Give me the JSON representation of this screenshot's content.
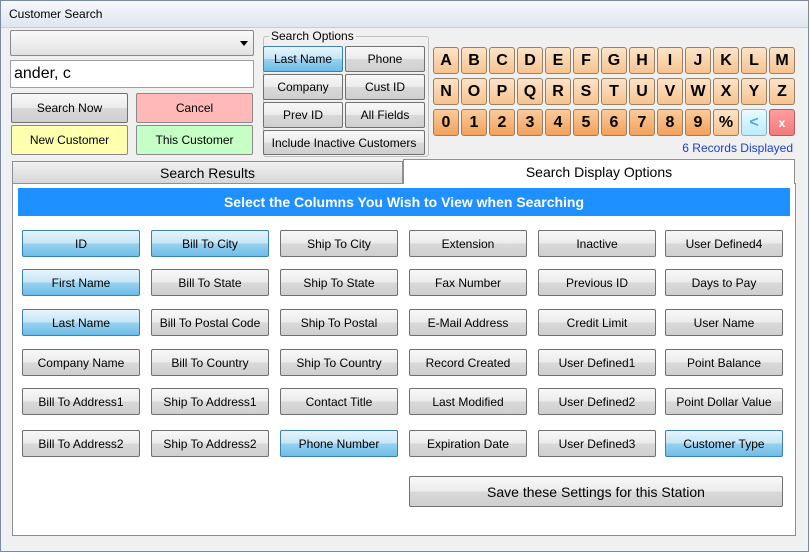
{
  "window": {
    "title": "Customer Search"
  },
  "search": {
    "combo_value": "",
    "text_value": "ander, c",
    "search_now": "Search Now",
    "cancel": "Cancel",
    "new_customer": "New Customer",
    "this_customer": "This Customer"
  },
  "options": {
    "legend": "Search Options",
    "last_name": "Last Name",
    "phone": "Phone",
    "company": "Company",
    "cust_id": "Cust ID",
    "prev_id": "Prev ID",
    "all_fields": "All Fields",
    "include_inactive": "Include Inactive Customers",
    "selected": "Last Name"
  },
  "keyboard": {
    "row1": [
      "A",
      "B",
      "C",
      "D",
      "E",
      "F",
      "G",
      "H",
      "I",
      "J",
      "K",
      "L",
      "M"
    ],
    "row2": [
      "N",
      "O",
      "P",
      "Q",
      "R",
      "S",
      "T",
      "U",
      "V",
      "W",
      "X",
      "Y",
      "Z"
    ],
    "row3": [
      "0",
      "1",
      "2",
      "3",
      "4",
      "5",
      "6",
      "7",
      "8",
      "9",
      "%",
      "<",
      "x"
    ]
  },
  "records_text": "6 Records Displayed",
  "tabs": {
    "results": "Search Results",
    "display_options": "Search Display Options",
    "active": "Search Display Options"
  },
  "banner": "Select the Columns You Wish to View when Searching",
  "columns": [
    [
      {
        "label": "ID",
        "selected": true
      },
      {
        "label": "Bill To City",
        "selected": true
      },
      {
        "label": "Ship To City",
        "selected": false
      },
      {
        "label": "Extension",
        "selected": false
      },
      {
        "label": "Inactive",
        "selected": false
      },
      {
        "label": "User Defined4",
        "selected": false
      }
    ],
    [
      {
        "label": "First Name",
        "selected": true
      },
      {
        "label": "Bill To State",
        "selected": false
      },
      {
        "label": "Ship To State",
        "selected": false
      },
      {
        "label": "Fax Number",
        "selected": false
      },
      {
        "label": "Previous ID",
        "selected": false
      },
      {
        "label": "Days to Pay",
        "selected": false
      }
    ],
    [
      {
        "label": "Last Name",
        "selected": true
      },
      {
        "label": "Bill To Postal Code",
        "selected": false
      },
      {
        "label": "Ship To Postal",
        "selected": false
      },
      {
        "label": "E-Mail Address",
        "selected": false
      },
      {
        "label": "Credit Limit",
        "selected": false
      },
      {
        "label": "User Name",
        "selected": false
      }
    ],
    [
      {
        "label": "Company Name",
        "selected": false
      },
      {
        "label": "Bill To Country",
        "selected": false
      },
      {
        "label": "Ship To Country",
        "selected": false
      },
      {
        "label": "Record Created",
        "selected": false
      },
      {
        "label": "User Defined1",
        "selected": false
      },
      {
        "label": "Point Balance",
        "selected": false
      }
    ],
    [
      {
        "label": "Bill To Address1",
        "selected": false
      },
      {
        "label": "Ship To Address1",
        "selected": false
      },
      {
        "label": "Contact Title",
        "selected": false
      },
      {
        "label": "Last Modified",
        "selected": false
      },
      {
        "label": "User Defined2",
        "selected": false
      },
      {
        "label": "Point Dollar Value",
        "selected": false
      }
    ],
    [
      {
        "label": "Bill To Address2",
        "selected": false
      },
      {
        "label": "Ship To Address2",
        "selected": false
      },
      {
        "label": "Phone Number",
        "selected": true
      },
      {
        "label": "Expiration Date",
        "selected": false
      },
      {
        "label": "User Defined3",
        "selected": false
      },
      {
        "label": "Customer Type",
        "selected": true
      }
    ]
  ],
  "save_button": "Save these Settings for this Station",
  "colors": {
    "banner": "#1e90ff",
    "records_text": "#1a3fd0",
    "selected_button": "#98d1ef",
    "key_letter": "#f6c38f",
    "key_number": "#f3a15a"
  }
}
